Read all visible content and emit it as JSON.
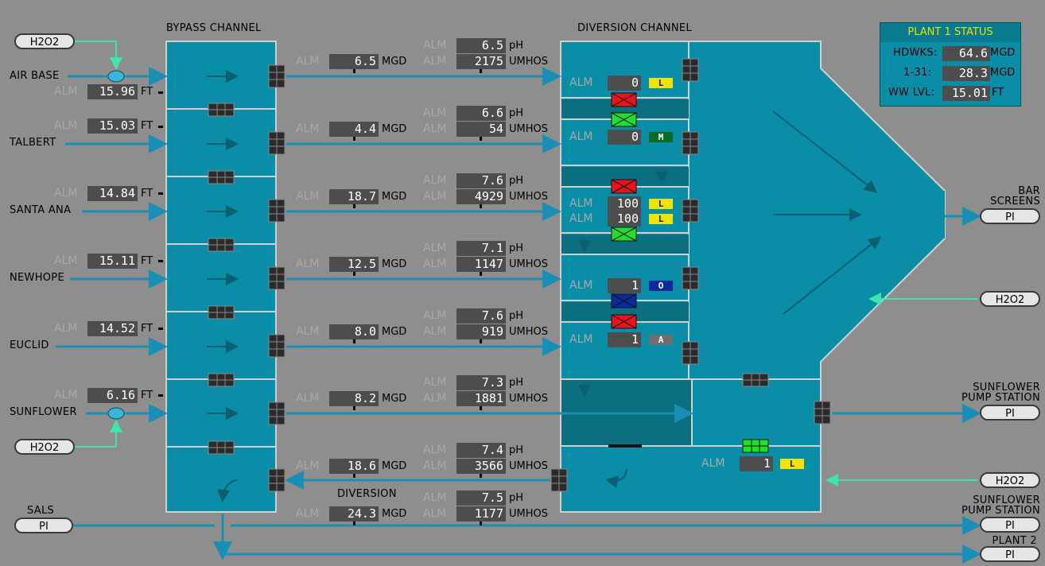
{
  "headers": {
    "bypass": "BYPASS CHANNEL",
    "diversion": "DIVERSION CHANNEL",
    "diversion_bottom": "DIVERSION"
  },
  "alm": "ALM",
  "units": {
    "ft": "FT",
    "mgd": "MGD",
    "ph": "pH",
    "umhos": "UMHOS"
  },
  "status": {
    "title": "PLANT 1 STATUS",
    "hdwks_label": "HDWKS:",
    "hdwks_value": "64.6",
    "hdwks_unit": "MGD",
    "r131_label": "1-31:",
    "r131_value": "28.3",
    "r131_unit": "MGD",
    "wwlvl_label": "WW LVL:",
    "wwlvl_value": "15.01",
    "wwlvl_unit": "FT"
  },
  "sources": {
    "air_base": "AIR BASE",
    "talbert": "TALBERT",
    "santa_ana": "SANTA ANA",
    "newhope": "NEWHOPE",
    "euclid": "EUCLID",
    "sunflower": "SUNFLOWER",
    "sals": "SALS"
  },
  "levels": {
    "air_base": "15.96",
    "talbert": "15.03",
    "santa_ana": "14.84",
    "newhope": "15.11",
    "euclid": "14.52",
    "sunflower": "6.16"
  },
  "flows": {
    "r1": "6.5",
    "r2": "4.4",
    "r3": "18.7",
    "r4": "12.5",
    "r5": "8.0",
    "r6": "8.2",
    "r7": "18.6",
    "r8": "24.3"
  },
  "ph": {
    "r1": "6.5",
    "r2": "6.6",
    "r3": "7.6",
    "r4": "7.1",
    "r5": "7.6",
    "r6": "7.3",
    "r7": "7.4",
    "r8": "7.5"
  },
  "umhos": {
    "r1": "2175",
    "r2": "54",
    "r3": "4929",
    "r4": "1147",
    "r5": "919",
    "r6": "1881",
    "r7": "3566",
    "r8": "1177"
  },
  "gates": {
    "g1_val": "0",
    "g1_tag": "L",
    "g2_val": "0",
    "g2_tag": "M",
    "g3_val": "100",
    "g3_tag": "L",
    "g4_val": "100",
    "g4_tag": "L",
    "g5_val": "1",
    "g5_tag": "O",
    "g6_val": "1",
    "g6_tag": "A",
    "g7_val": "1",
    "g7_tag": "L"
  },
  "buttons": {
    "h2o2": "H2O2",
    "pi": "PI"
  },
  "outputs": {
    "bar_line1": "BAR",
    "bar_line2": "SCREENS",
    "sun1_line1": "SUNFLOWER",
    "sun1_line2": "PUMP STATION",
    "sun2_line1": "SUNFLOWER",
    "sun2_line2": "PUMP STATION",
    "plant2": "PLANT 2"
  },
  "colors": {
    "channel": "#0a8ea8",
    "pipe": "#1a8fb5",
    "h2o2_line": "#3de6b0",
    "valve_closed": "#e8141c",
    "valve_open": "#22e02a"
  }
}
